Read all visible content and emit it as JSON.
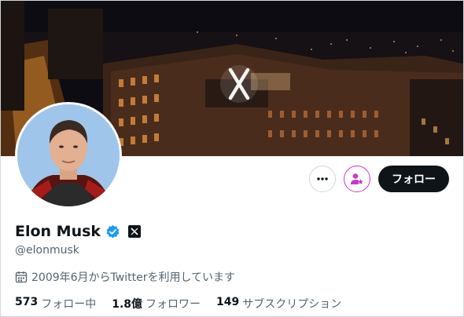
{
  "profile": {
    "name": "Elon Musk",
    "handle": "@elonmusk",
    "joined": "2009年6月からTwitterを利用しています"
  },
  "actions": {
    "follow_label": "フォロー"
  },
  "stats": [
    {
      "number": "573",
      "label": "フォロー中"
    },
    {
      "number": "1.8億",
      "label": "フォロワー"
    },
    {
      "number": "149",
      "label": "サブスクリプション"
    }
  ],
  "icons": {
    "verified": "verified-badge-icon",
    "affiliation": "x-logo-icon",
    "more": "more-icon",
    "subscribe": "subscribe-icon",
    "calendar": "calendar-icon"
  },
  "colors": {
    "verified_blue": "#1d9bf0",
    "follow_bg": "#0f1419",
    "subscribe_accent": "#c936cc",
    "secondary_text": "#536471"
  }
}
